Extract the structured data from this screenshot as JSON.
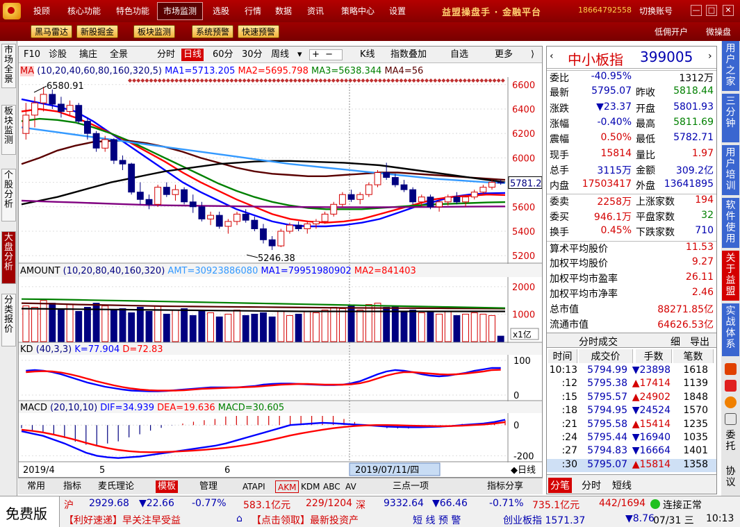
{
  "menu": {
    "items": [
      "投顾",
      "核心功能",
      "特色功能",
      "市场监测",
      "选股",
      "行情",
      "数据",
      "资讯",
      "策略中心",
      "设置"
    ],
    "active": "市场监测",
    "brand": "益盟操盘手 · 金融平台",
    "phone": "18664792558",
    "switch": "切换账号",
    "min": "—",
    "max": "□",
    "close": "✕"
  },
  "toolbar": {
    "buttons": [
      "黑马雷达",
      "新股掘金",
      "板块监测",
      "系统预警",
      "快速预警"
    ],
    "right": [
      "低佣开户",
      "微操盘"
    ]
  },
  "left_tabs": [
    "市场全景",
    "板块监测",
    "个股分析",
    "大盘分析",
    "分类报价"
  ],
  "left_tab_selected": "大盘分析",
  "chart_toolbar": {
    "f10": "F10",
    "items": [
      "诊股",
      "擒庄",
      "全景"
    ],
    "periods": [
      "分时",
      "日线",
      "60分",
      "30分",
      "周线"
    ],
    "selected": "日线",
    "right": [
      "K线",
      "指数叠加",
      "自选",
      "更多"
    ]
  },
  "ma_panel": {
    "label": "MA",
    "params": "(10,20,40,60,80,160,320,5)",
    "ma1": "MA1=5713.205",
    "ma2": "MA2=5695.798",
    "ma3": "MA3=5638.344",
    "ma4": "MA4=56",
    "high_label": "6580.91",
    "low_label": "5246.38",
    "current_price_tag": "5781.27",
    "yticks": [
      "6600",
      "6400",
      "6200",
      "6000",
      "5800",
      "5600",
      "5400",
      "5200"
    ]
  },
  "amount_panel": {
    "label": "AMOUNT",
    "params": "(10,20,80,40,160,320)",
    "amt": "AMT=30923886080",
    "ma1": "MA1=79951980902",
    "ma2": "MA2=841403",
    "yticks": [
      "2000",
      "1000"
    ],
    "unit": "x1亿"
  },
  "kd_panel": {
    "label": "KD",
    "params": "(40,3,3)",
    "k": "K=77.904",
    "d": "D=72.83",
    "yticks": [
      "100",
      "0"
    ]
  },
  "macd_panel": {
    "label": "MACD",
    "params": "(20,10,10)",
    "dif": "DIF=34.939",
    "dea": "DEA=19.636",
    "macd": "MACD=30.605",
    "yticks": [
      "0",
      "-200"
    ]
  },
  "xaxis": {
    "labels": [
      "2019/4",
      "5",
      "6"
    ],
    "cursor_date": "2019/07/11/四",
    "period": "日线"
  },
  "bottom_tabs": [
    "常用",
    "指标",
    "麦氏理论",
    "模板",
    "管理",
    "ATAPI",
    "AKM",
    "KDM",
    "ABC",
    "AV",
    "三点一项",
    "指标分享"
  ],
  "bottom_tab_selected": "模板",
  "quote": {
    "name": "中小板指",
    "code": "399005",
    "rows": [
      {
        "l1": "委比",
        "v1": "-40.95%",
        "l2": "",
        "v2": "1312万"
      },
      {
        "l1": "最新",
        "v1": "5795.07",
        "l2": "昨收",
        "v2": "5818.44"
      },
      {
        "l1": "涨跌",
        "v1": "▼23.37",
        "l2": "开盘",
        "v2": "5801.93"
      },
      {
        "l1": "涨幅",
        "v1": "-0.40%",
        "l2": "最高",
        "v2": "5811.69"
      },
      {
        "l1": "震幅",
        "v1": "0.50%",
        "l2": "最低",
        "v2": "5782.71"
      },
      {
        "l1": "现手",
        "v1": "15814",
        "l2": "量比",
        "v2": "1.97"
      },
      {
        "l1": "总手",
        "v1": "3115万",
        "l2": "金额",
        "v2": "309.2亿"
      },
      {
        "l1": "内盘",
        "v1": "17503417",
        "l2": "外盘",
        "v2": "13641895"
      },
      {
        "l1": "委卖",
        "v1": "2258万",
        "l2": "上涨家数",
        "v2": "194"
      },
      {
        "l1": "委买",
        "v1": "946.1万",
        "l2": "平盘家数",
        "v2": "32"
      },
      {
        "l1": "换手",
        "v1": "0.45%",
        "l2": "下跌家数",
        "v2": "710"
      }
    ],
    "stats": [
      {
        "l": "算术平均股价",
        "v": "11.53"
      },
      {
        "l": "加权平均股价",
        "v": "9.27"
      },
      {
        "l": "加权平均市盈率",
        "v": "26.11"
      },
      {
        "l": "加权平均市净率",
        "v": "2.46"
      },
      {
        "l": "总市值",
        "v": "88271.85亿"
      },
      {
        "l": "流通市值",
        "v": "64626.53亿"
      }
    ]
  },
  "ticks": {
    "title": "分时成交",
    "detail": "细",
    "export": "导出",
    "headers": [
      "时间",
      "成交价",
      "手数",
      "笔数"
    ],
    "rows": [
      [
        "10:13",
        "5794.99",
        "▼23898",
        "1618"
      ],
      [
        ":12",
        "5795.38",
        "▲17414",
        "1139"
      ],
      [
        ":15",
        "5795.57",
        "▲24902",
        "1848"
      ],
      [
        ":18",
        "5794.95",
        "▼24524",
        "1570"
      ],
      [
        ":21",
        "5795.58",
        "▲15414",
        "1235"
      ],
      [
        ":24",
        "5795.44",
        "▼16940",
        "1035"
      ],
      [
        ":27",
        "5794.83",
        "▼16664",
        "1401"
      ],
      [
        ":30",
        "5795.07",
        "▲15814",
        "1358"
      ]
    ],
    "tabs": [
      "分笔",
      "分时",
      "短线"
    ]
  },
  "right_side": [
    "用户之家",
    "三分钟",
    "用户培训",
    "软件使用",
    "关于益盟",
    "实战体系",
    "委托",
    "协议"
  ],
  "status": {
    "edition": "免费版",
    "sh": {
      "name": "沪",
      "price": "2929.68",
      "chg": "▼22.66",
      "pct": "-0.77%",
      "amount": "583.1亿元",
      "ratio": "229/1204"
    },
    "sz": {
      "name": "深",
      "price": "9332.64",
      "chg": "▼66.46",
      "pct": "-0.71%",
      "amount": "735.1亿元",
      "ratio": "442/1694"
    },
    "conn": "连接正常",
    "news1": "【利好速递】早关注早受益",
    "news2": "【点击领取】最新投资产",
    "alert": "短 线 预 警",
    "cyb": "创业板指 1571.37",
    "cyb_chg": "▼8.76",
    "date": "07/31 三",
    "time": "10:13"
  },
  "colors": {
    "up": "#d40000",
    "down": "#000080",
    "ma1": "#0000ff",
    "ma2": "#ff0000",
    "ma3": "#008000",
    "ma4": "#5a0000",
    "ma5": "#000000",
    "ma6": "#3399ff",
    "ma7": "#800080"
  },
  "chart_data": {
    "type": "candlestick",
    "ohlc": [
      [
        6200,
        6450,
        6150,
        6350
      ],
      [
        6350,
        6500,
        6250,
        6450
      ],
      [
        6450,
        6580.91,
        6380,
        6520
      ],
      [
        6520,
        6560,
        6400,
        6440
      ],
      [
        6440,
        6500,
        6330,
        6380
      ],
      [
        6380,
        6470,
        6350,
        6430
      ],
      [
        6430,
        6450,
        6280,
        6300
      ],
      [
        6300,
        6330,
        6150,
        6200
      ],
      [
        6200,
        6220,
        6050,
        6080
      ],
      [
        6080,
        6180,
        6050,
        6150
      ],
      [
        6150,
        6160,
        5950,
        5980
      ],
      [
        5980,
        6020,
        5900,
        5950
      ],
      [
        5950,
        5960,
        5700,
        5720
      ],
      [
        5720,
        5800,
        5620,
        5660
      ],
      [
        5660,
        5700,
        5580,
        5620
      ],
      [
        5620,
        5780,
        5600,
        5760
      ],
      [
        5760,
        5800,
        5680,
        5700
      ],
      [
        5700,
        5780,
        5650,
        5740
      ],
      [
        5740,
        5760,
        5620,
        5640
      ],
      [
        5640,
        5700,
        5550,
        5600
      ],
      [
        5600,
        5640,
        5480,
        5500
      ],
      [
        5500,
        5560,
        5450,
        5530
      ],
      [
        5530,
        5560,
        5420,
        5440
      ],
      [
        5440,
        5500,
        5380,
        5480
      ],
      [
        5480,
        5560,
        5450,
        5540
      ],
      [
        5540,
        5580,
        5470,
        5490
      ],
      [
        5490,
        5520,
        5400,
        5420
      ],
      [
        5420,
        5460,
        5300,
        5330
      ],
      [
        5330,
        5360,
        5246.38,
        5280
      ],
      [
        5280,
        5420,
        5270,
        5400
      ],
      [
        5400,
        5470,
        5380,
        5450
      ],
      [
        5450,
        5480,
        5400,
        5420
      ],
      [
        5420,
        5480,
        5380,
        5460
      ],
      [
        5460,
        5500,
        5420,
        5480
      ],
      [
        5480,
        5560,
        5460,
        5540
      ],
      [
        5540,
        5640,
        5520,
        5620
      ],
      [
        5620,
        5720,
        5600,
        5700
      ],
      [
        5700,
        5740,
        5640,
        5660
      ],
      [
        5660,
        5720,
        5620,
        5700
      ],
      [
        5700,
        5800,
        5680,
        5780
      ],
      [
        5780,
        5900,
        5760,
        5880
      ],
      [
        5880,
        5960,
        5820,
        5840
      ],
      [
        5840,
        5870,
        5760,
        5780
      ],
      [
        5780,
        5820,
        5720,
        5740
      ],
      [
        5740,
        5760,
        5620,
        5640
      ],
      [
        5640,
        5700,
        5600,
        5680
      ],
      [
        5680,
        5700,
        5580,
        5600
      ],
      [
        5600,
        5660,
        5560,
        5640
      ],
      [
        5640,
        5700,
        5610,
        5680
      ],
      [
        5680,
        5720,
        5620,
        5640
      ],
      [
        5640,
        5700,
        5600,
        5680
      ],
      [
        5680,
        5740,
        5660,
        5720
      ],
      [
        5720,
        5780,
        5700,
        5760
      ],
      [
        5760,
        5820,
        5740,
        5800
      ],
      [
        5800,
        5820,
        5780,
        5795.07
      ]
    ],
    "ma": {
      "MA1": [
        6480,
        6450,
        6420,
        6380,
        6300,
        6200,
        6100,
        6000,
        5900,
        5800,
        5720,
        5650,
        5580,
        5530,
        5480,
        5450,
        5440,
        5440,
        5450,
        5470,
        5500,
        5550,
        5600,
        5640,
        5680,
        5700,
        5710,
        5713.205
      ],
      "MA2": [
        6380,
        6400,
        6380,
        6330,
        6270,
        6200,
        6130,
        6050,
        5970,
        5880,
        5800,
        5730,
        5660,
        5600,
        5540,
        5500,
        5480,
        5470,
        5480,
        5500,
        5540,
        5580,
        5620,
        5660,
        5680,
        5690,
        5700,
        5695.798
      ],
      "MA3": [
        6300,
        6320,
        6310,
        6290,
        6250,
        6200,
        6140,
        6070,
        6000,
        5930,
        5860,
        5790,
        5730,
        5680,
        5640,
        5610,
        5590,
        5580,
        5580,
        5580,
        5590,
        5600,
        5610,
        5620,
        5625,
        5630,
        5635,
        5638.344
      ],
      "MA4": [
        5950,
        6000,
        6060,
        6100,
        6130,
        6140,
        6140,
        6120,
        6090,
        6050,
        6000,
        5960,
        5920,
        5890,
        5870,
        5860,
        5850,
        5850,
        5860,
        5870,
        5880,
        5880,
        5870,
        5860,
        5850,
        5840,
        5830,
        5820
      ],
      "MA5": [
        5620,
        5650,
        5680,
        5720,
        5760,
        5800,
        5830,
        5860,
        5890,
        5910,
        5930,
        5950,
        5960,
        5970,
        5975,
        5975,
        5970,
        5965,
        5960,
        5950,
        5940,
        5920,
        5900,
        5880,
        5860,
        5840,
        5820,
        5800
      ],
      "MA6": [
        6250,
        6230,
        6210,
        6190,
        6170,
        6150,
        6130,
        6110,
        6090,
        6070,
        6050,
        6030,
        6010,
        5990,
        5970,
        5950,
        5935,
        5920,
        5905,
        5890,
        5875,
        5860,
        5845,
        5830,
        5820,
        5810,
        5800,
        5795
      ],
      "MA7": [
        5650,
        5645,
        5640,
        5635,
        5630,
        5625,
        5620,
        5615,
        5612,
        5610,
        5608,
        5606,
        5604,
        5602,
        5600,
        5599,
        5598,
        5597,
        5596,
        5596,
        5596,
        5597,
        5598,
        5599,
        5600,
        5601,
        5602,
        5603
      ]
    },
    "ylim": [
      5150,
      6650
    ],
    "amount": [
      1300,
      1250,
      1500,
      1400,
      1200,
      1350,
      1100,
      1250,
      1400,
      1300,
      1150,
      1200,
      1050,
      1250,
      1100,
      1300,
      1000,
      1150,
      1200,
      950,
      1100,
      1050,
      900,
      1000,
      1150,
      950,
      1000,
      1050,
      900,
      1100,
      950,
      1000,
      1100,
      1050,
      1150,
      1250,
      1200,
      1300,
      1150,
      1350,
      1400,
      1250,
      1300,
      1100,
      1150,
      1050,
      1100,
      1000,
      1100,
      950,
      1000,
      1050,
      1000,
      950,
      200
    ],
    "kd_ylim": [
      0,
      100
    ],
    "K": [
      70,
      72,
      70,
      66,
      60,
      52,
      44,
      36,
      30,
      24,
      20,
      16,
      13,
      12,
      11,
      11,
      12,
      14,
      16,
      18,
      20,
      22,
      22,
      22,
      22,
      24,
      26,
      30,
      32,
      33,
      33,
      32,
      31,
      30,
      29,
      29,
      30,
      34,
      40,
      50,
      60,
      68,
      72,
      70,
      66,
      60,
      56,
      54,
      56,
      60,
      64,
      70,
      74,
      78,
      77.904
    ],
    "D": [
      66,
      68,
      69,
      68,
      65,
      60,
      54,
      47,
      40,
      34,
      28,
      23,
      19,
      16,
      14,
      13,
      13,
      13,
      14,
      16,
      18,
      19,
      20,
      21,
      22,
      23,
      24,
      26,
      28,
      30,
      31,
      32,
      32,
      31,
      30,
      30,
      30,
      31,
      34,
      40,
      48,
      56,
      62,
      66,
      66,
      64,
      62,
      60,
      59,
      60,
      62,
      65,
      68,
      72,
      72.83
    ],
    "macd_ylim": [
      -230,
      60
    ],
    "DIF": [
      -40,
      -55,
      -70,
      -95,
      -120,
      -150,
      -180,
      -200,
      -210,
      -215,
      -210,
      -205,
      -195,
      -185,
      -175,
      -165,
      -155,
      -145,
      -135,
      -120,
      -100,
      -80,
      -60,
      -40,
      -20,
      0,
      5,
      10,
      15,
      12,
      8,
      4,
      0,
      -5,
      -10,
      -12,
      -14,
      -14,
      -12,
      -10,
      -6,
      0,
      5,
      10,
      20,
      34.939
    ],
    "DEA": [
      -30,
      -38,
      -48,
      -62,
      -78,
      -96,
      -116,
      -134,
      -150,
      -162,
      -170,
      -175,
      -177,
      -176,
      -174,
      -170,
      -166,
      -161,
      -155,
      -148,
      -139,
      -128,
      -115,
      -100,
      -84,
      -68,
      -54,
      -42,
      -30,
      -20,
      -12,
      -6,
      -2,
      0,
      0,
      -1,
      -3,
      -5,
      -6,
      -7,
      -6,
      -4,
      0,
      4,
      10,
      19.636
    ]
  }
}
